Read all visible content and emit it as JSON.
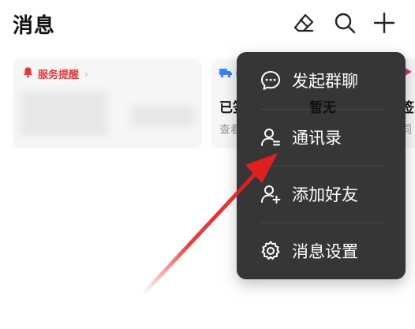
{
  "header": {
    "title": "消息",
    "icons": [
      "eraser-icon",
      "search-icon",
      "plus-icon"
    ]
  },
  "cards": [
    {
      "header_label": "服务提醒",
      "accent": "#e4393c"
    },
    {
      "header_label": "物流",
      "status": "已签收",
      "sub": "查看详情",
      "status2": "暂无",
      "accent": "#3b82f6"
    },
    {
      "status": "签",
      "sub": "同"
    }
  ],
  "menu": {
    "items": [
      {
        "label": "发起群聊",
        "icon": "chat-bubble-icon"
      },
      {
        "label": "通讯录",
        "icon": "contacts-icon"
      },
      {
        "label": "添加好友",
        "icon": "add-friend-icon"
      },
      {
        "label": "消息设置",
        "icon": "gear-icon"
      }
    ]
  },
  "colors": {
    "menu_bg": "#363636",
    "arrow": "#e02020",
    "service_red": "#e4393c",
    "logistics_blue": "#3b82f6"
  }
}
